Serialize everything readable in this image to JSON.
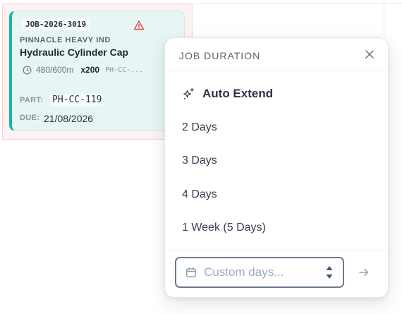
{
  "job_card": {
    "job_id": "JOB-2026-3019",
    "customer": "PINNACLE HEAVY IND",
    "part_name": "Hydraulic Cylinder Cap",
    "duration": "480/600m",
    "quantity": "x200",
    "code_truncated": "PH-CC-...",
    "part_label": "PART:",
    "part_value": "PH-CC-119",
    "due_label": "DUE:",
    "due_value": "21/08/2026",
    "accent_color": "#14b8a6",
    "warning_color": "#ef4444",
    "icons": [
      "warning-icon",
      "clock-icon"
    ]
  },
  "popover": {
    "title": "JOB DURATION",
    "close_icon": "close-icon",
    "options": [
      {
        "label": "Auto Extend",
        "icon": "sparkle-icon"
      },
      {
        "label": "2 Days"
      },
      {
        "label": "3 Days"
      },
      {
        "label": "4 Days"
      },
      {
        "label": "1 Week (5 Days)"
      }
    ],
    "custom_input": {
      "placeholder": "Custom days...",
      "value": "",
      "icon": "calendar-icon"
    },
    "submit_icon": "arrow-right-icon"
  }
}
